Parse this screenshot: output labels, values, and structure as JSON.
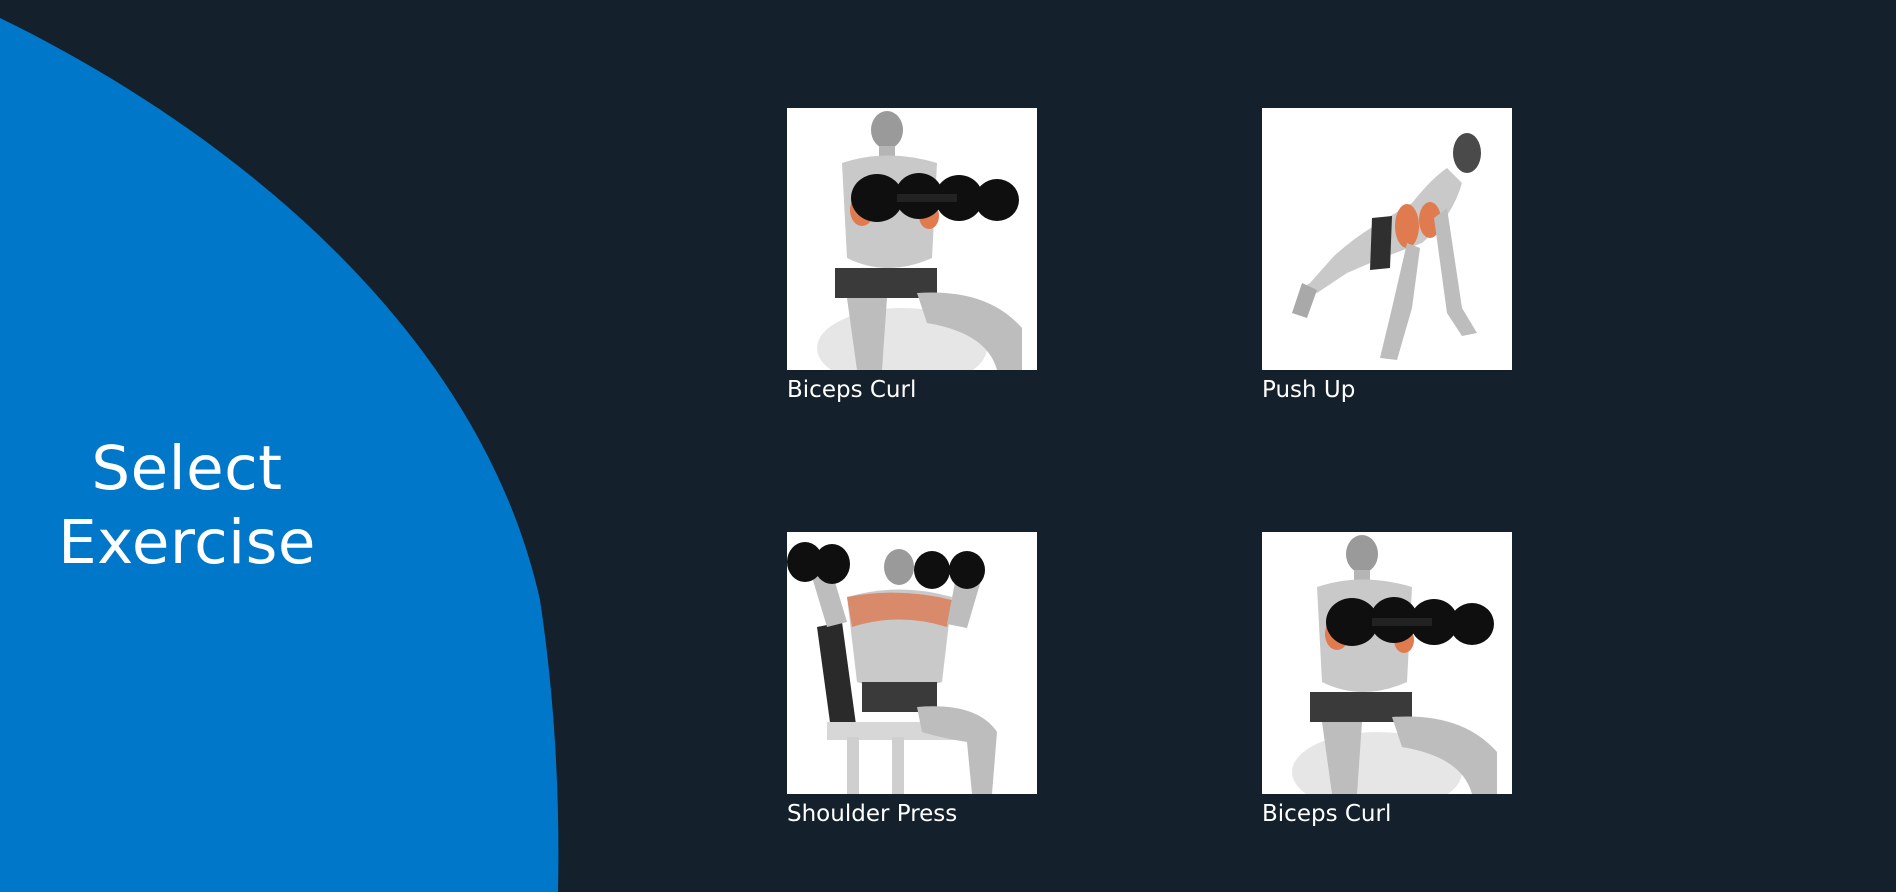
{
  "page": {
    "title_line1": "Select",
    "title_line2": "Exercise",
    "background_color": "#14202b",
    "accent_color": "#0077c8"
  },
  "exercises": [
    {
      "label": "Biceps Curl",
      "image": "biceps-curl-illustration"
    },
    {
      "label": "Push Up",
      "image": "push-up-illustration"
    },
    {
      "label": "Shoulder Press",
      "image": "shoulder-press-illustration"
    },
    {
      "label": "Biceps Curl",
      "image": "biceps-curl-illustration"
    }
  ]
}
